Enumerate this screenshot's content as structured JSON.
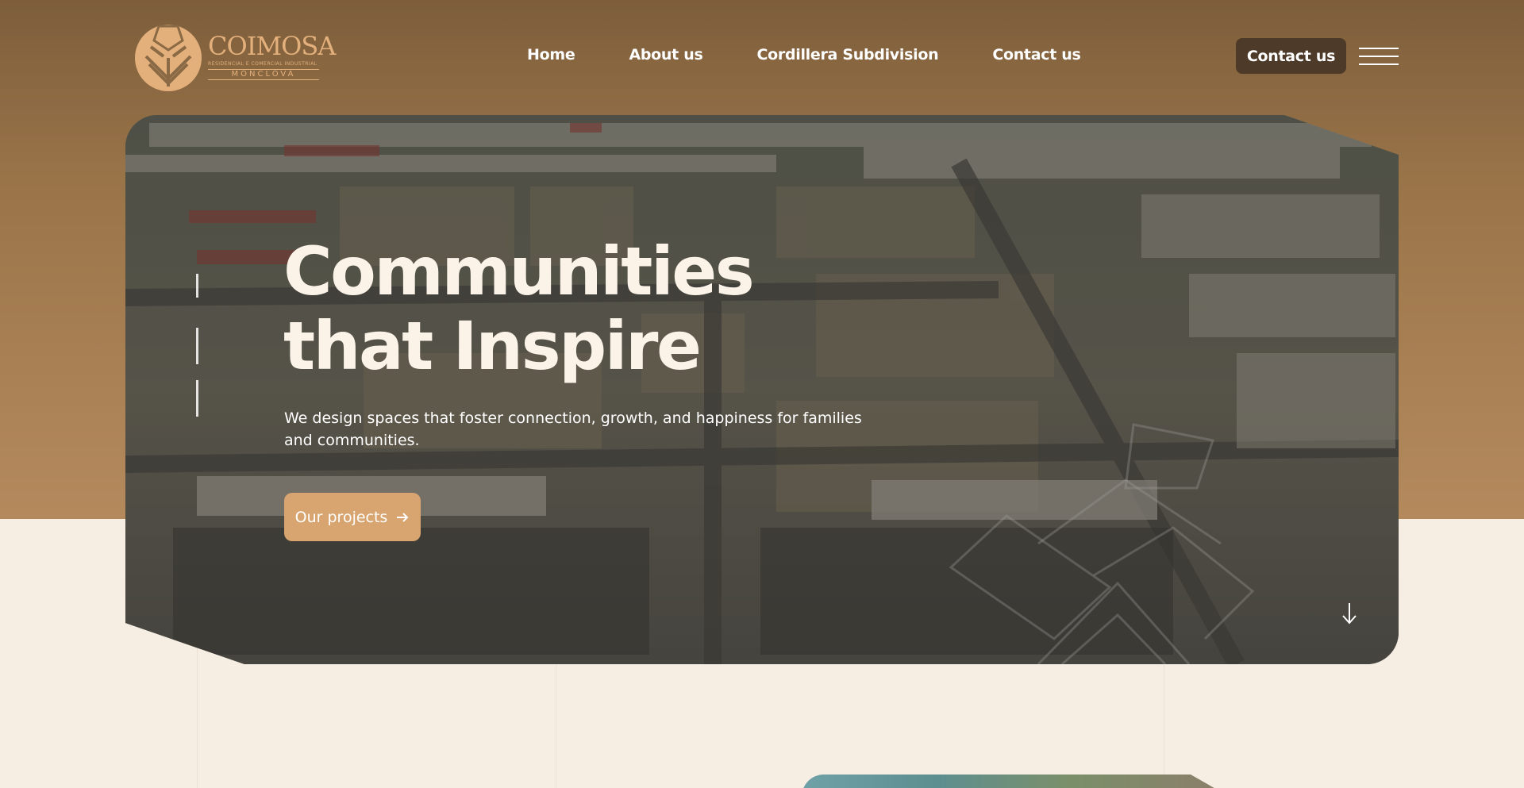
{
  "brand": {
    "name": "COIMOSA",
    "subtitle": "RESIDENCIAL E COMERCIAL INDUSTRIAL",
    "city": "MONCLOVA",
    "logo_icon": "logo-icon",
    "color_gold": "#e3b07c"
  },
  "nav": {
    "items": [
      {
        "label": "Home"
      },
      {
        "label": "About us"
      },
      {
        "label": "Cordillera Subdivision"
      },
      {
        "label": "Contact us"
      }
    ]
  },
  "header": {
    "cta_label": "Contact us",
    "menu_icon": "hamburger-menu-icon"
  },
  "hero": {
    "title": "Communities that Inspire",
    "description": "We design spaces that foster connection, growth, and happiness for families and communities.",
    "button_label": "Our projects",
    "button_icon": "arrow-right-icon",
    "scroll_icon": "arrow-down-icon",
    "button_color": "#d8a46f"
  },
  "colors": {
    "header_brown": "#7d5e3b",
    "cream": "#f6ede3",
    "cta_dark": "#4d3a28"
  }
}
